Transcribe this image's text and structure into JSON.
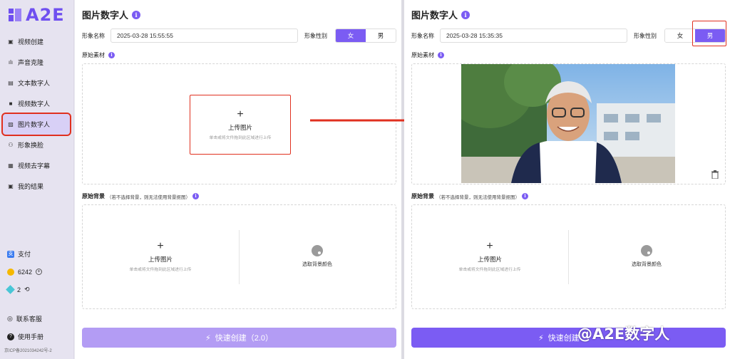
{
  "brand": {
    "name": "A2E"
  },
  "sidebar": {
    "items": [
      {
        "label": "视频创建",
        "icon": "video-create-icon"
      },
      {
        "label": "声音克隆",
        "icon": "voice-icon"
      },
      {
        "label": "文本数字人",
        "icon": "text-avatar-icon"
      },
      {
        "label": "视频数字人",
        "icon": "video-avatar-icon"
      },
      {
        "label": "图片数字人",
        "icon": "image-avatar-icon"
      },
      {
        "label": "形象换脸",
        "icon": "face-swap-icon"
      },
      {
        "label": "视频去字幕",
        "icon": "subtitle-remove-icon"
      },
      {
        "label": "我的结果",
        "icon": "results-icon"
      }
    ],
    "pay": "支付",
    "coins": "6242",
    "gems": "2",
    "support": "联系客服",
    "manual": "使用手册",
    "icp": "京ICP备2021034242号-2"
  },
  "left": {
    "title": "图片数字人",
    "name_label": "形象名称",
    "name_value": "2025-03-28 15:55:55",
    "gender_label": "形象性别",
    "gender_female": "女",
    "gender_male": "男",
    "material_label": "原始素材",
    "upload_title": "上传图片",
    "upload_sub": "单击或将文件拖到此区域进行上传",
    "bg_label": "原始背景",
    "bg_hint": "（若不选择背景，则无法使用背景抠图）",
    "bg_upload_title": "上传图片",
    "bg_upload_sub": "单击或将文件拖到此区域进行上传",
    "bg_color": "选取背景颜色",
    "create": "快速创建（2.0）"
  },
  "right": {
    "title": "图片数字人",
    "name_label": "形象名称",
    "name_value": "2025-03-28 15:35:35",
    "gender_label": "形象性别",
    "gender_female": "女",
    "gender_male": "男",
    "material_label": "原始素材",
    "bg_label": "原始背景",
    "bg_hint": "（若不选择背景，则无法使用背景抠图）",
    "bg_upload_title": "上传图片",
    "bg_upload_sub": "单击或将文件拖到此区域进行上传",
    "bg_color": "选取背景颜色",
    "create": "快速创建"
  },
  "watermark": "@A2E数字人",
  "colors": {
    "accent": "#7b5cf3",
    "highlight": "#e0301f",
    "button_light": "#b39cf4"
  }
}
